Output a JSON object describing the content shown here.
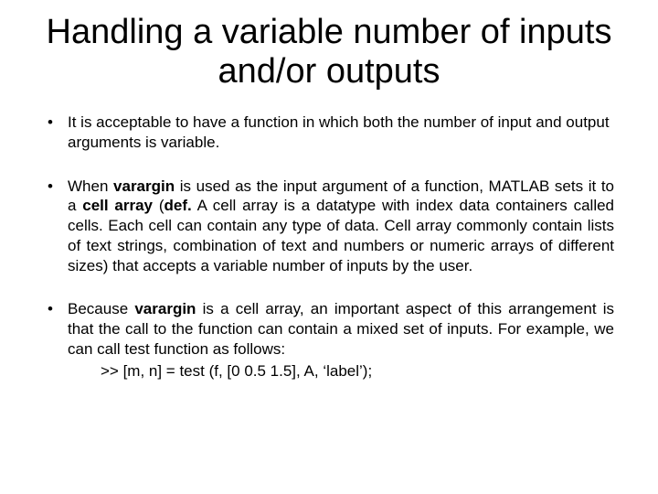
{
  "title": "Handling a variable number of inputs and/or outputs",
  "b1": "It is acceptable to have a function in which both the number of input and output arguments is variable.",
  "b2_a": "When ",
  "b2_b": "varargin",
  "b2_c": " is used as the input argument of a function, MATLAB sets it to a ",
  "b2_d": "cell array",
  "b2_e": " (",
  "b2_f": "def.",
  "b2_g": " A cell array is a datatype with index data containers called cells. Each cell can contain any type of data. Cell array commonly contain lists of text strings, combination of text and numbers or numeric arrays of different sizes) that accepts a variable number of inputs by the user.",
  "b3_a": "Because ",
  "b3_b": "varargin",
  "b3_c": " is a cell array, an important aspect of this arrangement is that the call to the function can contain a mixed set of inputs. For example, we can call test function as follows:",
  "code": ">> [m, n] = test (f, [0   0.5  1.5], A, ‘label’);"
}
